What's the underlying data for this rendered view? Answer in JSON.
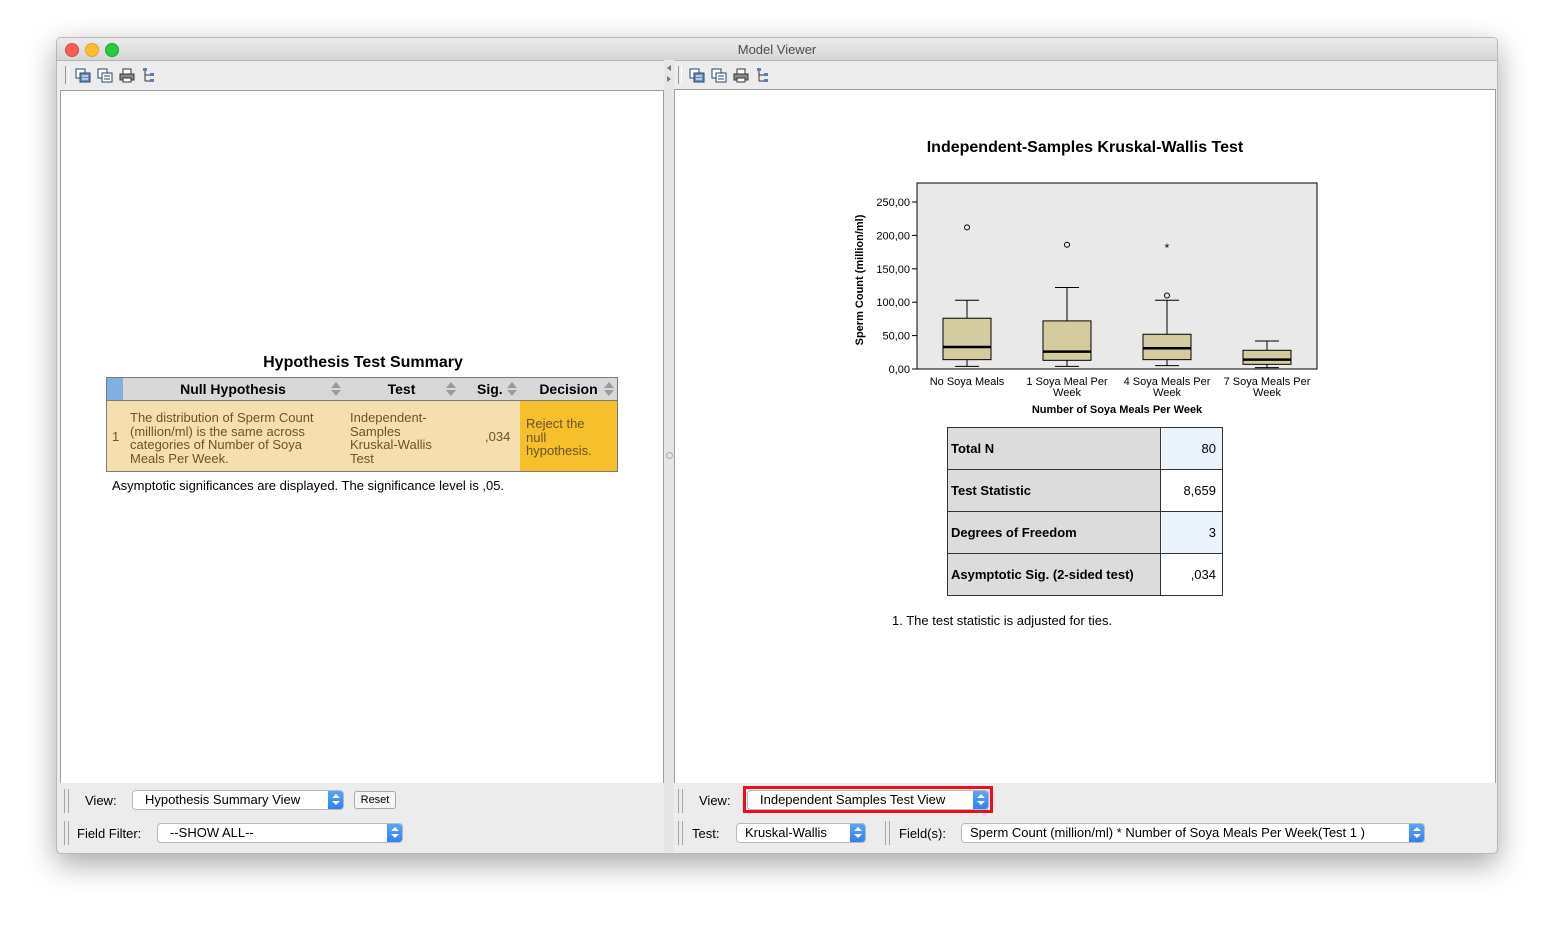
{
  "window": {
    "title": "Model Viewer"
  },
  "left": {
    "toolbar_icons": [
      "copy-icon",
      "copy-special-icon",
      "print-icon",
      "tree-icon"
    ],
    "hypothesis": {
      "title": "Hypothesis Test Summary",
      "columns": [
        "Null Hypothesis",
        "Test",
        "Sig.",
        "Decision"
      ],
      "row": {
        "index": "1",
        "null_hypothesis": [
          "The distribution of Sperm Count",
          "(million/ml) is the same across",
          "categories of Number of Soya",
          "Meals Per Week."
        ],
        "test": [
          "Independent-",
          "Samples",
          "Kruskal-Wallis",
          "Test"
        ],
        "sig": ",034",
        "decision": [
          "Reject the",
          "null",
          "hypothesis."
        ]
      },
      "footnote": "Asymptotic significances are displayed.  The significance level is ,05."
    },
    "controls": {
      "view_label": "View:",
      "view_value": "Hypothesis Summary View",
      "reset_label": "Reset",
      "field_filter_label": "Field Filter:",
      "field_filter_value": "--SHOW ALL--"
    }
  },
  "right": {
    "toolbar_icons": [
      "copy-icon",
      "copy-special-icon",
      "print-icon",
      "tree-icon"
    ],
    "chart_title": "Independent-Samples Kruskal-Wallis Test",
    "chart_data": {
      "type": "boxplot",
      "title": "Independent-Samples Kruskal-Wallis Test",
      "xlabel": "Number of Soya Meals Per Week",
      "ylabel": "Sperm Count (million/ml)",
      "ylim": [
        0,
        250
      ],
      "yticks": [
        "0,00",
        "50,00",
        "100,00",
        "150,00",
        "200,00",
        "250,00"
      ],
      "ytick_values": [
        0,
        50,
        100,
        150,
        200,
        250
      ],
      "categories": [
        [
          "No Soya Meals"
        ],
        [
          "1 Soya Meal Per",
          "Week"
        ],
        [
          "4 Soya Meals Per",
          "Week"
        ],
        [
          "7 Soya Meals Per",
          "Week"
        ]
      ],
      "boxes": [
        {
          "min": 4,
          "q1": 14,
          "median": 33,
          "q3": 76,
          "max": 103,
          "outliers": [
            {
              "value": 212,
              "symbol": "o"
            }
          ]
        },
        {
          "min": 4,
          "q1": 13,
          "median": 26,
          "q3": 72,
          "max": 122,
          "outliers": [
            {
              "value": 186,
              "symbol": "o"
            }
          ]
        },
        {
          "min": 5,
          "q1": 14,
          "median": 31,
          "q3": 52,
          "max": 103,
          "outliers": [
            {
              "value": 110,
              "symbol": "o"
            },
            {
              "value": 183,
              "symbol": "*"
            }
          ]
        },
        {
          "min": 2,
          "q1": 7,
          "median": 14,
          "q3": 28,
          "max": 42,
          "outliers": []
        }
      ],
      "colors": {
        "box_fill": "#d4cc9e",
        "plot_bg": "#e9e9e9"
      }
    },
    "stats": [
      {
        "label": "Total N",
        "value": "80",
        "highlight": true
      },
      {
        "label": "Test Statistic",
        "value": "8,659",
        "highlight": false
      },
      {
        "label": "Degrees of Freedom",
        "value": "3",
        "highlight": true
      },
      {
        "label": "Asymptotic Sig. (2-sided test)",
        "value": ",034",
        "highlight": false
      }
    ],
    "footnote": "1.  The test statistic is adjusted for ties.",
    "controls": {
      "view_label": "View:",
      "view_value": "Independent Samples Test View",
      "test_label": "Test:",
      "test_value": "Kruskal-Wallis",
      "fields_label": "Field(s):",
      "fields_value": "Sperm Count (million/ml) * Number of Soya Meals Per Week(Test 1 )"
    }
  },
  "colors": {
    "decision_bg": "#f5c02c",
    "row_bg": "#f5dfb0",
    "highlight_box": "#e8101e",
    "value_highlight": "#eaf3fb"
  }
}
